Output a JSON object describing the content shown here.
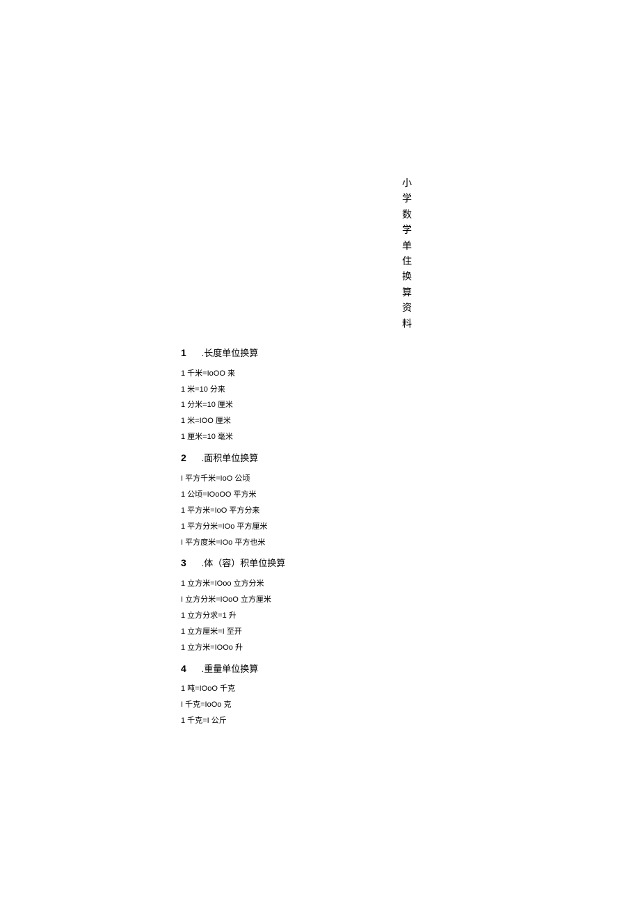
{
  "title": {
    "chars": [
      "小",
      "学",
      "数",
      "学",
      "单",
      "住",
      "换",
      "算",
      "资",
      "料"
    ]
  },
  "sections": [
    {
      "num": "1",
      "label": ".长度单位换算",
      "items": [
        "1 千米=IoOO 来",
        "1 米=10 分来",
        "1 分米=10 厘米",
        "1 米=IOO 厘米",
        "1 厘米=10 毫米"
      ]
    },
    {
      "num": "2",
      "label": ".面积单位换算",
      "items": [
        "I 平方千米=IoO 公顷",
        "1 公顷=IOoOO 平方米",
        "1 平方米=IoO 平方分来",
        "1 平方分米=IOo 平方厘米",
        "I 平方度米=IOo 平方也米"
      ]
    },
    {
      "num": "3",
      "label": ".体（容）积单位换算",
      "items": [
        "1 立方米=IOoo 立方分米",
        "I 立方分米=IOoO 立方厘米",
        "1 立方分求=1 升",
        "1 立方厘米=I 至开",
        "1 立方米=IOOo 升"
      ]
    },
    {
      "num": "4",
      "label": ".重量单位换算",
      "items": [
        "1 吨=IOoO 千克",
        "I 千克=IoOo 克",
        "1 千克=I 公斤"
      ]
    }
  ]
}
